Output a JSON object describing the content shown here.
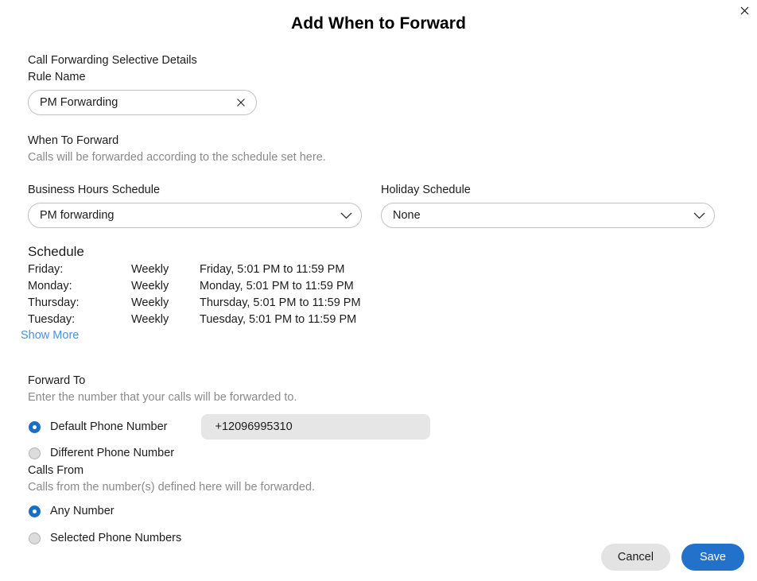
{
  "dialog": {
    "title": "Add When to Forward",
    "close_icon": "close-icon"
  },
  "details": {
    "section_label": "Call Forwarding Selective Details",
    "rule_name_label": "Rule Name",
    "rule_name_value": "PM Forwarding",
    "rule_name_placeholder": "Rule Name",
    "clear_icon": "clear-icon"
  },
  "when_to_forward": {
    "heading": "When To Forward",
    "description": "Calls will be forwarded according to the schedule set here.",
    "business_hours_label": "Business Hours Schedule",
    "business_hours_value": "PM forwarding",
    "holiday_label": "Holiday Schedule",
    "holiday_value": "None",
    "chevron_icon": "chevron-down-icon"
  },
  "schedule": {
    "heading": "Schedule",
    "rows": [
      {
        "day": "Friday:",
        "frequency": "Weekly",
        "detail": "Friday, 5:01 PM to 11:59 PM"
      },
      {
        "day": "Monday:",
        "frequency": "Weekly",
        "detail": "Monday, 5:01 PM to 11:59 PM"
      },
      {
        "day": "Thursday:",
        "frequency": "Weekly",
        "detail": "Thursday, 5:01 PM to 11:59 PM"
      },
      {
        "day": "Tuesday:",
        "frequency": "Weekly",
        "detail": "Tuesday, 5:01 PM to 11:59 PM"
      }
    ],
    "show_more_label": "Show More"
  },
  "forward_to": {
    "heading": "Forward To",
    "description": "Enter the number that your calls will be forwarded to.",
    "options": [
      {
        "label": "Default Phone Number",
        "selected": true
      },
      {
        "label": "Different Phone Number",
        "selected": false
      }
    ],
    "phone_number": "+12096995310"
  },
  "calls_from": {
    "heading": "Calls From",
    "description": "Calls from the number(s) defined here will be forwarded.",
    "options": [
      {
        "label": "Any Number",
        "selected": true
      },
      {
        "label": "Selected Phone Numbers",
        "selected": false
      }
    ]
  },
  "footer": {
    "cancel_label": "Cancel",
    "save_label": "Save"
  },
  "colors": {
    "accent_blue": "#2272cc",
    "radio_blue": "#1a6fc4",
    "link_blue": "#4a90e2",
    "cancel_gray": "#e3e3e3",
    "field_gray": "#e6e6e6"
  }
}
